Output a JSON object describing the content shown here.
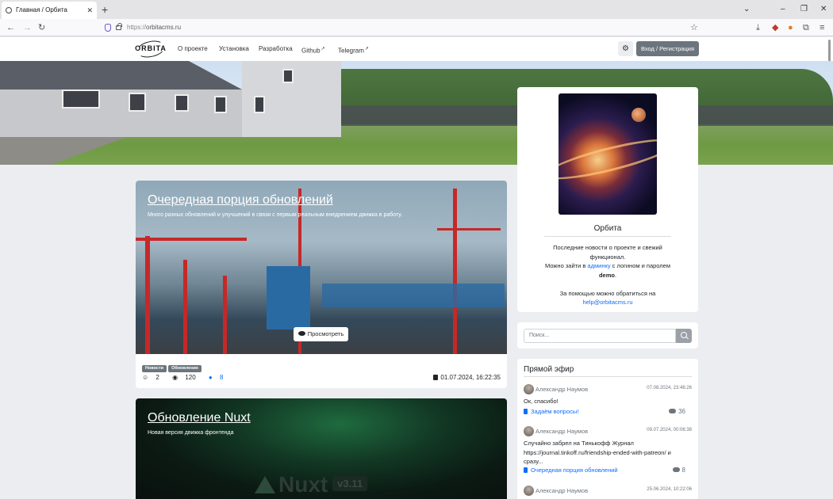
{
  "browser": {
    "tab_title": "Главная / Орбита",
    "url_prefix": "https://",
    "url_domain": "orbitacms.ru"
  },
  "header": {
    "logo_text": "ORBITA",
    "menu": [
      "О проекте",
      "Установка",
      "Разработка",
      "Github",
      "Telegram"
    ],
    "login_label": "Вход / Регистрация"
  },
  "posts": [
    {
      "title": "Очередная порция обновлений",
      "subtitle": "Много разных обновлений и улучшений в связи с первым реальным внедрением движка в работу.",
      "view_label": "Просмотреть",
      "tags": [
        "Новости",
        "Обновление"
      ],
      "reactions": "2",
      "views": "120",
      "comments": "8",
      "date": "01.07.2024, 16:22:35"
    },
    {
      "title": "Обновление Nuxt",
      "subtitle": "Новая версия движка фронтенда",
      "image_logo": "Nuxt",
      "image_version": "v3.11"
    }
  ],
  "profile": {
    "name": "Орбита",
    "line1": "Последние новости о проекте и свежий функционал.",
    "line2_pre": "Можно зайти в ",
    "line2_link": "админку",
    "line2_post": " с логином и паролем ",
    "login_name": "demo",
    "line3": "За помощью можно обратиться на",
    "email": "help@orbitacms.ru"
  },
  "search": {
    "placeholder": "Поиск..."
  },
  "live": {
    "title": "Прямой эфир",
    "comments": [
      {
        "author": "Александр Наумов",
        "time": "07.08.2024, 23:46:26",
        "text": "Ок, спасибо!",
        "post": "Задаём вопросы!",
        "count": "36"
      },
      {
        "author": "Александр Наумов",
        "time": "09.07.2024, 00:06:38",
        "text": "Случайно забрел на Тинькофф Журнал https://journal.tinkoff.ru/friendship-ended-with-patreon/ и сразу...",
        "post": "Очередная порция обновлений",
        "count": "8"
      },
      {
        "author": "Александр Наумов",
        "time": "25.06.2024, 10:22:06"
      }
    ]
  },
  "colors": {
    "accent": "#0d6efd",
    "secondary_button": "#6c757d",
    "background": "#ebedf0"
  }
}
